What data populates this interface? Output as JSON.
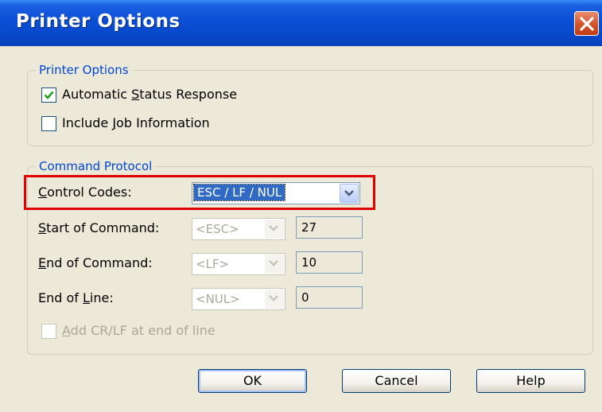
{
  "window": {
    "title": "Printer Options"
  },
  "printer_options": {
    "group_label": "Printer Options",
    "automatic_status_response": {
      "label": "Automatic Status Response",
      "checked": true
    },
    "include_job_information": {
      "label": "Include Job Information",
      "checked": false
    }
  },
  "command_protocol": {
    "group_label": "Command Protocol",
    "control_codes": {
      "label": "Control Codes:",
      "value": "ESC / LF / NUL"
    },
    "start_of_command": {
      "label": "Start of Command:",
      "select": "<ESC>",
      "code": "27"
    },
    "end_of_command": {
      "label": "End of Command:",
      "select": "<LF>",
      "code": "10"
    },
    "end_of_line": {
      "label": "End of Line:",
      "select": "<NUL>",
      "code": "0"
    },
    "add_cr_lf": {
      "label": "Add CR/LF at end of line",
      "checked": false,
      "enabled": false
    }
  },
  "buttons": {
    "ok": "OK",
    "cancel": "Cancel",
    "help": "Help"
  },
  "colors": {
    "title_bar": "#0a4fd6",
    "group_label": "#0046d5",
    "highlight": "#e00000",
    "selection": "#316ac5"
  },
  "icons": {
    "close": "close-icon",
    "check": "checkmark-icon",
    "dropdown": "chevron-down-icon"
  }
}
